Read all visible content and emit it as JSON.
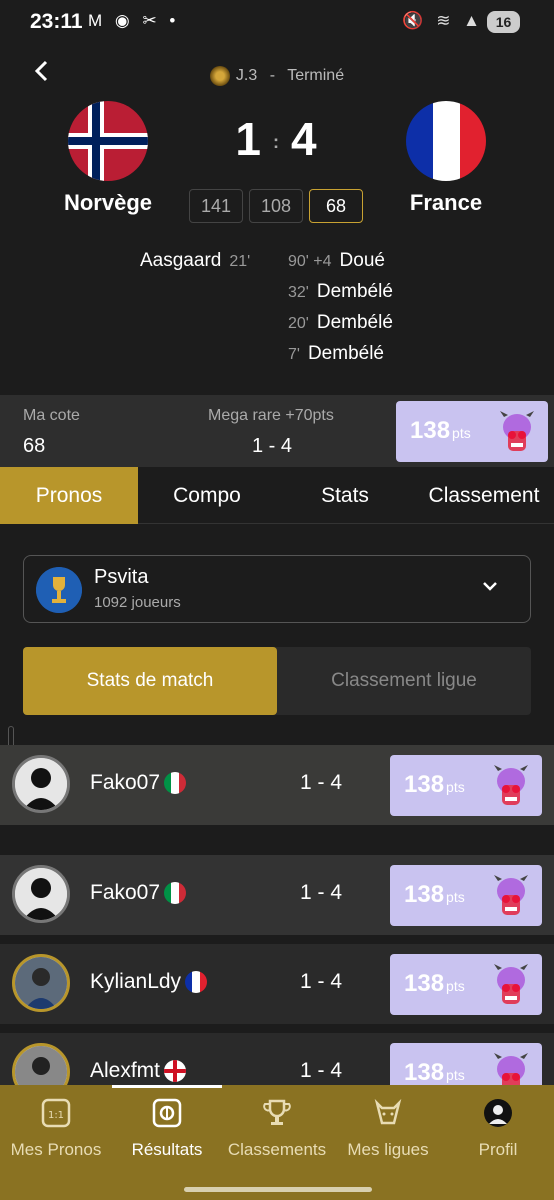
{
  "status": {
    "time": "23:11",
    "left_icons": "M ◉ ✂ •",
    "right_icons": "🔇 ≋ ▲",
    "battery": "16"
  },
  "match": {
    "round": "J.3",
    "separator": "-",
    "state": "Terminé",
    "home": {
      "name": "Norvège",
      "score": "1"
    },
    "away": {
      "name": "France",
      "score": "4"
    },
    "score_sep": ":",
    "odds": [
      "141",
      "108",
      "68"
    ],
    "home_scorers": [
      {
        "name": "Aasgaard",
        "minute": "21'"
      }
    ],
    "away_scorers": [
      {
        "minute": "90' +4",
        "name": "Doué"
      },
      {
        "minute": "32'",
        "name": "Dembélé"
      },
      {
        "minute": "20'",
        "name": "Dembélé"
      },
      {
        "minute": "7'",
        "name": "Dembélé"
      }
    ]
  },
  "cote": {
    "my_label": "Ma cote",
    "my_value": "68",
    "rare_label": "Mega rare +70pts",
    "rare_value": "1 - 4",
    "points": "138",
    "points_unit": "pts"
  },
  "tabs": [
    "Pronos",
    "Compo",
    "Stats",
    "Classement"
  ],
  "league": {
    "name": "Psvita",
    "players": "1092 joueurs"
  },
  "toggle": {
    "active": "Stats de match",
    "inactive": "Classement ligue"
  },
  "players": [
    {
      "name": "Fako07",
      "pred": "1 - 4",
      "points": "138",
      "unit": "pts"
    },
    {
      "name": "Fako07",
      "pred": "1 - 4",
      "points": "138",
      "unit": "pts"
    },
    {
      "name": "KylianLdy",
      "pred": "1 - 4",
      "points": "138",
      "unit": "pts"
    },
    {
      "name": "Alexfmt",
      "pred": "1 - 4",
      "points": "138",
      "unit": "pts"
    }
  ],
  "nav": [
    {
      "label": "Mes Pronos",
      "icon": "calendar-icon"
    },
    {
      "label": "Résultats",
      "icon": "ball-icon"
    },
    {
      "label": "Classements",
      "icon": "trophy-icon"
    },
    {
      "label": "Mes ligues",
      "icon": "bull-icon"
    },
    {
      "label": "Profil",
      "icon": "avatar-icon"
    }
  ],
  "colors": {
    "gold": "#b8962b",
    "points_bg": "#c9c3f0",
    "background": "#1c1c1c",
    "nav_bg": "#8a7222"
  }
}
